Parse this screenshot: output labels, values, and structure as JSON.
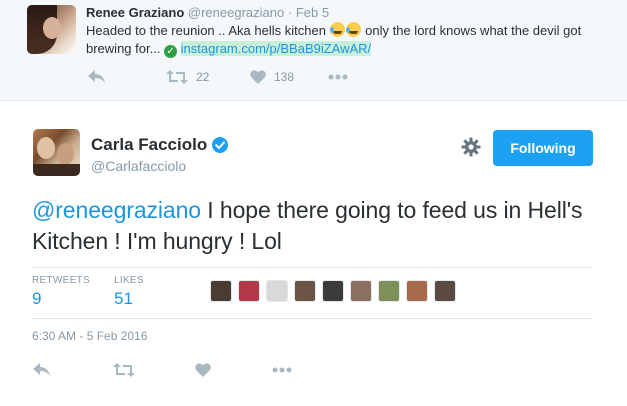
{
  "parent_tweet": {
    "fullname": "Renee Graziano",
    "handle": "@reneegraziano",
    "separator": "·",
    "time": "Feb 5",
    "text_before_emoji": "Headed to the reunion .. Aka hells kitchen ",
    "text_after_emoji": " only the lord knows what the devil got brewing for... ",
    "check_glyph": "✓",
    "link": "instagram.com/p/BBaB9iZAwAR/",
    "retweet_count": "22",
    "like_count": "138"
  },
  "main_tweet": {
    "fullname": "Carla Facciolo",
    "handle": "@Carlafacciolo",
    "follow_button_label": "Following",
    "mention": "@reneegraziano",
    "text": " I hope there going to feed us in Hell's Kitchen ! I'm hungry ! Lol",
    "retweets_label": "RETWEETS",
    "retweets_count": "9",
    "likes_label": "LIKES",
    "likes_count": "51",
    "timestamp": "6:30 AM - 5 Feb 2016"
  },
  "colors": {
    "accent_blue": "#1da1f2",
    "link_blue": "#1b95e0",
    "muted_gray": "#8899a6",
    "icon_gray": "#aab8c2"
  },
  "liker_avatars": [
    "#4a3b33",
    "#b23a48",
    "#d9d9d9",
    "#6b5346",
    "#3d3a3a",
    "#8a7060",
    "#7f8f5a",
    "#a86a4c",
    "#5a4a42"
  ],
  "icons": [
    "reply-icon",
    "retweet-icon",
    "heart-icon",
    "more-icon",
    "verified-badge-icon",
    "gear-icon",
    "check-circle-icon"
  ]
}
